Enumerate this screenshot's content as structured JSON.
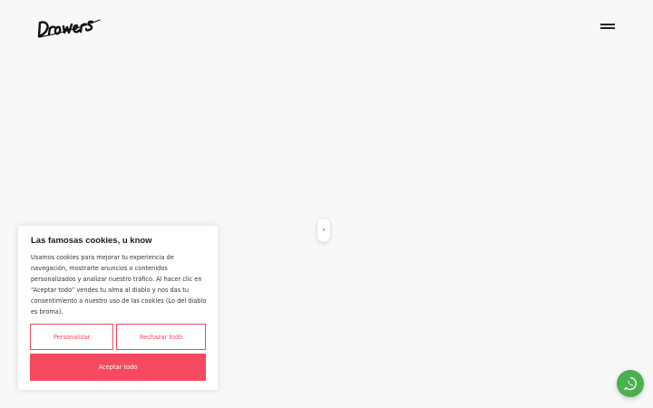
{
  "header": {
    "logo_text": "Drowers",
    "menu_icon": "hamburger-menu-icon"
  },
  "slider": {
    "handle_glyph": "›",
    "handle_icon": "chevron-right-icon"
  },
  "cookie_banner": {
    "title": "Las famosas cookies, u know",
    "body": "Usamos cookies para mejorar tu experiencia de navegación, mostrarte anuncios o contenidos personalizados y analizar nuestro tráfico. Al hacer clic en “Aceptar todo” vendes tu alma al diablo y nos das tu consentimiento a nuestro uso de las cookies (Lo del diablo es broma).",
    "customize_label": "Personalizar",
    "reject_label": "Rechazar todo",
    "accept_label": "Aceptar todo",
    "accent_color": "#f54a5f"
  },
  "whatsapp": {
    "icon": "whatsapp-icon",
    "color": "#4caf50"
  }
}
